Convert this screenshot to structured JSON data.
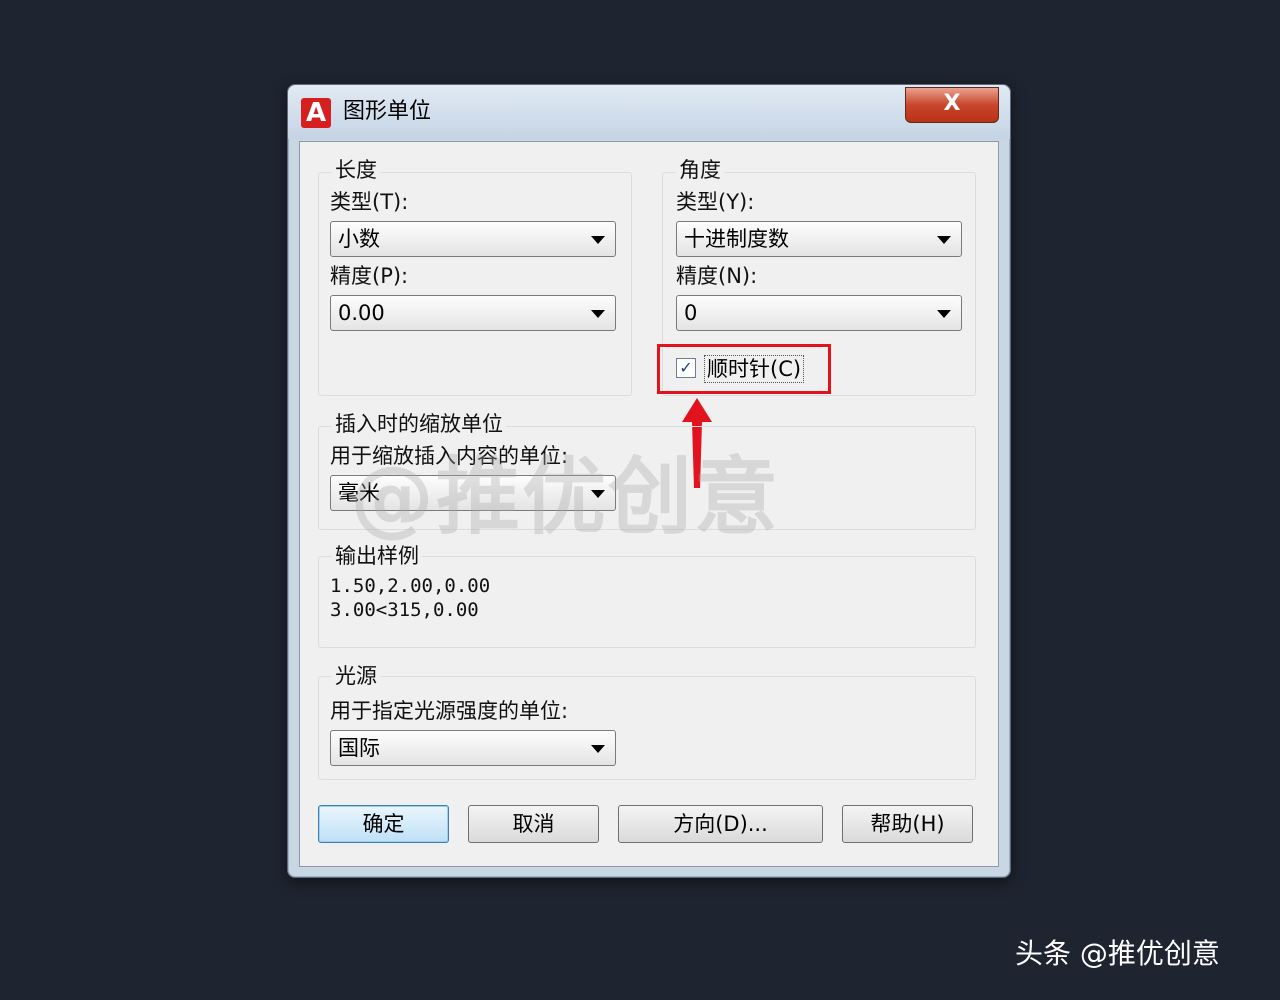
{
  "window": {
    "title": "图形单位",
    "close_glyph": "X",
    "app_icon_letter": "A"
  },
  "length": {
    "group_title": "长度",
    "type_label": "类型(T):",
    "type_value": "小数",
    "precision_label": "精度(P):",
    "precision_value": "0.00"
  },
  "angle": {
    "group_title": "角度",
    "type_label": "类型(Y):",
    "type_value": "十进制度数",
    "precision_label": "精度(N):",
    "precision_value": "0",
    "clockwise_label": "顺时针(C)",
    "clockwise_checked": true
  },
  "insert_scale": {
    "group_title": "插入时的缩放单位",
    "label": "用于缩放插入内容的单位:",
    "value": "毫米"
  },
  "sample_output": {
    "group_title": "输出样例",
    "line1": "1.50,2.00,0.00",
    "line2": "3.00<315,0.00"
  },
  "lighting": {
    "group_title": "光源",
    "label": "用于指定光源强度的单位:",
    "value": "国际"
  },
  "buttons": {
    "ok": "确定",
    "cancel": "取消",
    "direction": "方向(D)...",
    "help": "帮助(H)"
  },
  "annotation": {
    "highlight_color": "#e3131e"
  },
  "watermark": "@推优创意",
  "credit": "头条 @推优创意"
}
